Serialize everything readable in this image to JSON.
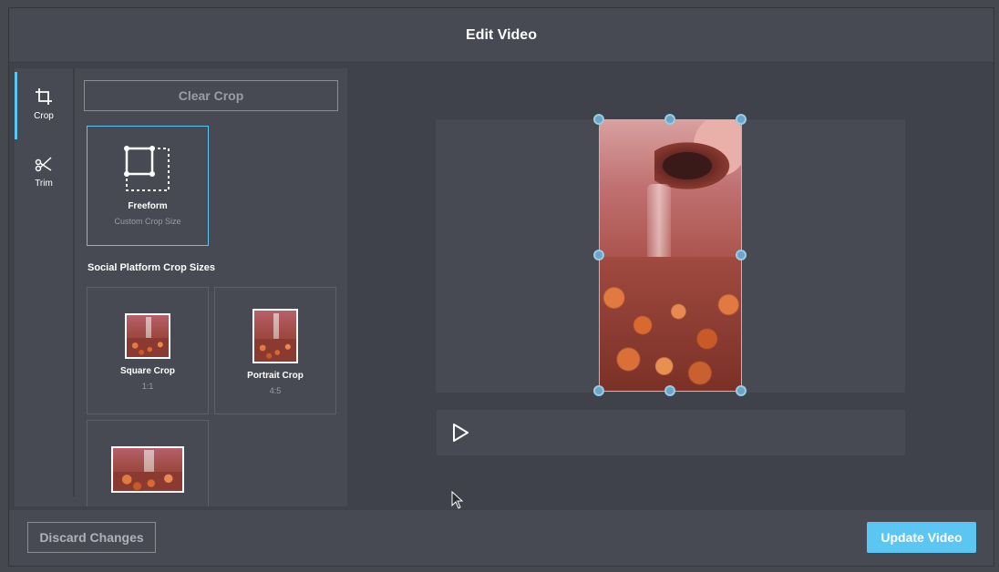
{
  "modal": {
    "title": "Edit Video"
  },
  "tools": [
    {
      "label": "Crop",
      "icon": "crop-icon",
      "active": true
    },
    {
      "label": "Trim",
      "icon": "scissors-icon",
      "active": false
    }
  ],
  "crop_panel": {
    "clear_label": "Clear Crop",
    "freeform": {
      "title": "Freeform",
      "subtitle": "Custom Crop Size",
      "icon": "freeform-crop-icon"
    },
    "social_heading": "Social Platform Crop Sizes",
    "presets": [
      {
        "title": "Square Crop",
        "ratio": "1:1"
      },
      {
        "title": "Portrait Crop",
        "ratio": "4:5"
      },
      {
        "title": "",
        "ratio": ""
      }
    ]
  },
  "player": {
    "play_icon": "play-icon"
  },
  "footer": {
    "discard_label": "Discard Changes",
    "update_label": "Update Video"
  },
  "colors": {
    "accent": "#5cc6f2",
    "panel": "#474a53",
    "background": "#3f424a"
  }
}
